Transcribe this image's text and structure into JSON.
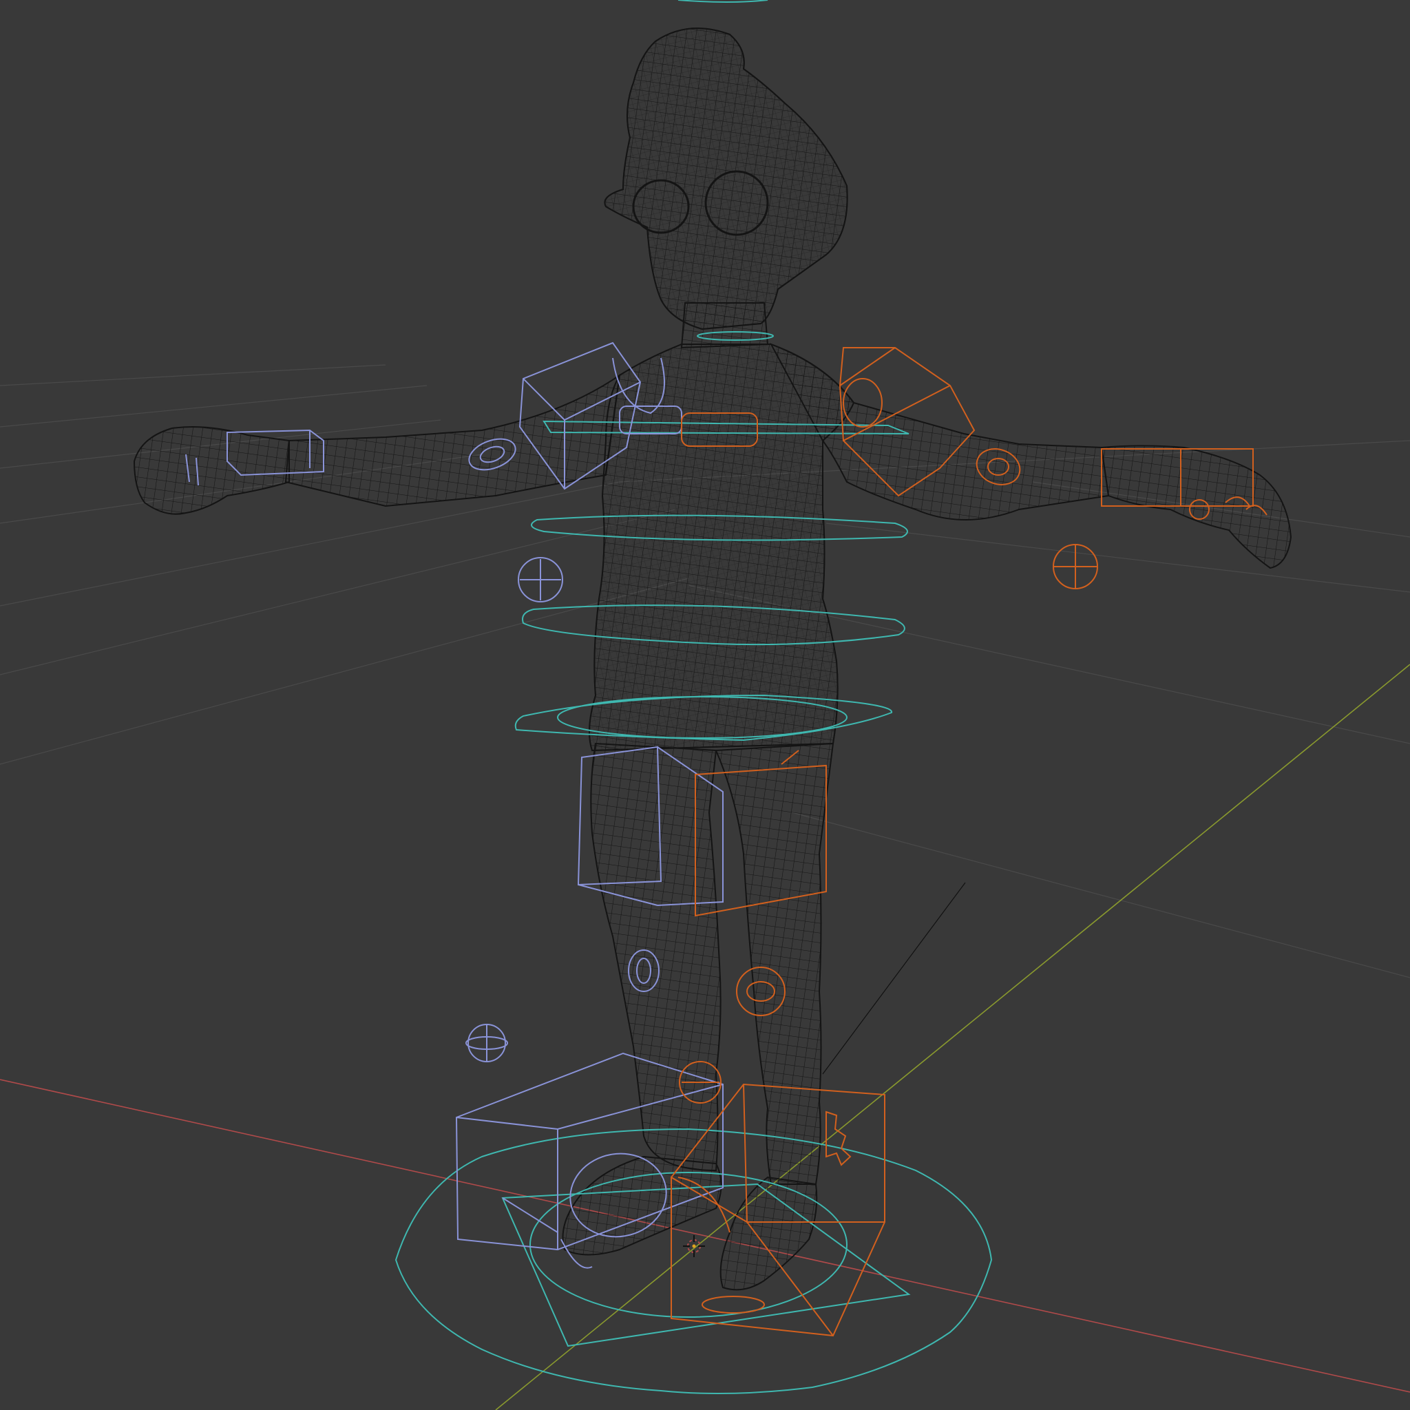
{
  "viewport": {
    "shading_mode": "wireframe",
    "background_color": "#393939",
    "grid_color": "#4a4a4a",
    "x_axis_color": "#b04a4a",
    "y_axis_color": "#8a9a2e",
    "mesh_color": "#141414"
  },
  "rig": {
    "left_side_color": "#8a93d8",
    "right_side_color": "#d2601e",
    "center_color": "#3fb8b0"
  },
  "scene": {
    "object": "character-mesh",
    "pose": "T-pose",
    "controls_visible": true
  }
}
